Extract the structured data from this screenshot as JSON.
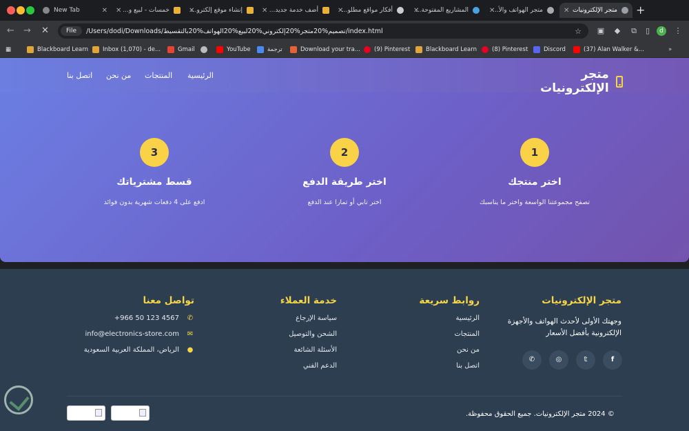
{
  "browser": {
    "tabs": [
      {
        "label": "New Tab",
        "dir": "ltr"
      },
      {
        "label": "خمسات - لبيع و..."
      },
      {
        "label": "إنشاء موقع إلكترو..."
      },
      {
        "label": "أضف خدمة جديد..."
      },
      {
        "label": "أفكار مواقع مطلو..."
      },
      {
        "label": "المشاريع المفتوحة..."
      },
      {
        "label": "متجر الهواتف والأ..."
      },
      {
        "label": "متجر الإلكترونيات"
      }
    ],
    "file_chip": "File",
    "url": "/Users/dodi/Downloads/تصميم%20متجر%20إلكتروني%20لبيع%20الهواتف%20بالتقسيط/index.html",
    "avatar_letter": "d",
    "bookmarks": [
      "Blackboard Learn",
      "Inbox (1,070) - de...",
      "Gmail",
      "",
      "YouTube",
      "ترجمة",
      "Download your tra...",
      "(9) Pinterest",
      "Blackboard Learn",
      "(8) Pinterest",
      "Discord",
      "(37) Alan Walker &..."
    ]
  },
  "site": {
    "brand": "متجر الإلكترونيات",
    "nav": [
      "الرئيسية",
      "المنتجات",
      "من نحن",
      "اتصل بنا"
    ],
    "steps": [
      {
        "num": "1",
        "title": "اختر منتجك",
        "desc": "تصفح مجموعتنا الواسعة واختر ما يناسبك"
      },
      {
        "num": "2",
        "title": "اختر طريقة الدفع",
        "desc": "اختر تابي أو تمارا عند الدفع"
      },
      {
        "num": "3",
        "title": "قسط مشترياتك",
        "desc": "ادفع على 4 دفعات شهرية بدون فوائد"
      }
    ]
  },
  "footer": {
    "about": {
      "title": "متجر الإلكترونيات",
      "text": "وجهتك الأولى لأحدث الهواتف والأجهزة الإلكترونية بأفضل الأسعار"
    },
    "quick_links": {
      "title": "روابط سريعة",
      "items": [
        "الرئيسية",
        "المنتجات",
        "من نحن",
        "اتصل بنا"
      ]
    },
    "customer_service": {
      "title": "خدمة العملاء",
      "items": [
        "سياسة الإرجاع",
        "الشحن والتوصيل",
        "الأسئلة الشائعة",
        "الدعم الفني"
      ]
    },
    "contact": {
      "title": "تواصل معنا",
      "phone": "+966 50 123 4567",
      "email": "info@electronics-store.com",
      "address": "الرياض، المملكة العربية السعودية"
    },
    "copyright": "© 2024 متجر الإلكترونيات. جميع الحقوق محفوظة."
  },
  "colors": {
    "accent": "#f5d547",
    "footer_bg": "#2c3e50",
    "hero_start": "#6b7fe3",
    "hero_end": "#7353ad"
  }
}
